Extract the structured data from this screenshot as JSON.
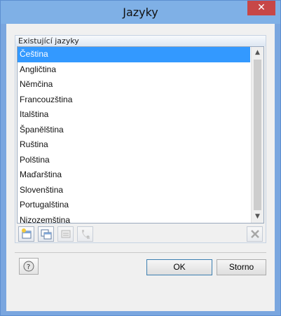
{
  "window": {
    "title": "Jazyky",
    "close_glyph": "✕"
  },
  "group": {
    "header": "Existující jazyky",
    "items": [
      {
        "label": "Čeština",
        "selected": true
      },
      {
        "label": "Angličtina"
      },
      {
        "label": "Němčina"
      },
      {
        "label": "Francouzština"
      },
      {
        "label": "Italština"
      },
      {
        "label": "Španělština"
      },
      {
        "label": "Ruština"
      },
      {
        "label": "Polština"
      },
      {
        "label": "Maďarština"
      },
      {
        "label": "Slovenština"
      },
      {
        "label": "Portugalština"
      },
      {
        "label": "Nizozemština"
      }
    ]
  },
  "toolbar": {
    "icons": [
      "new-language-icon",
      "copy-language-icon",
      "edit-language-icon",
      "phone-b-icon",
      "delete-icon"
    ]
  },
  "buttons": {
    "ok_label": "OK",
    "cancel_label": "Storno"
  },
  "colors": {
    "selection": "#3399ff",
    "close_button": "#c74747",
    "title_bar": "#7fb0e6"
  }
}
